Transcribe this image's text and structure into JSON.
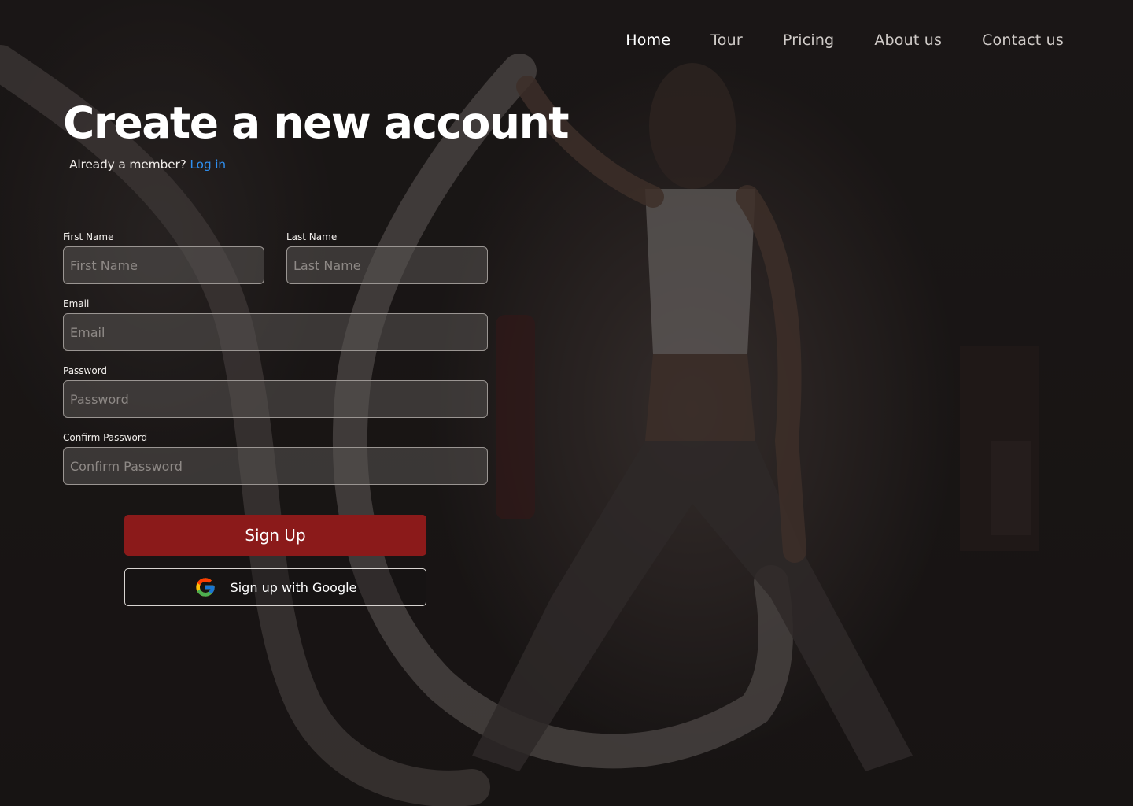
{
  "nav": {
    "items": [
      {
        "label": "Home",
        "active": true
      },
      {
        "label": "Tour",
        "active": false
      },
      {
        "label": "Pricing",
        "active": false
      },
      {
        "label": "About us",
        "active": false
      },
      {
        "label": "Contact us",
        "active": false
      }
    ]
  },
  "header": {
    "title": "Create a new account",
    "member_text": "Already a member?",
    "login_link": "Log in"
  },
  "form": {
    "first_name": {
      "label": "First Name",
      "placeholder": "First Name",
      "value": ""
    },
    "last_name": {
      "label": "Last Name",
      "placeholder": "Last Name",
      "value": ""
    },
    "email": {
      "label": "Email",
      "placeholder": "Email",
      "value": ""
    },
    "password": {
      "label": "Password",
      "placeholder": "Password",
      "value": ""
    },
    "confirm_password": {
      "label": "Confirm Password",
      "placeholder": "Confirm Password",
      "value": ""
    },
    "signup_label": "Sign Up",
    "google_label": "Sign up with Google"
  },
  "colors": {
    "accent": "#8b1a1a",
    "link": "#2f8ff0",
    "background": "#1a1716"
  },
  "icons": {
    "google": "google-logo-icon"
  }
}
